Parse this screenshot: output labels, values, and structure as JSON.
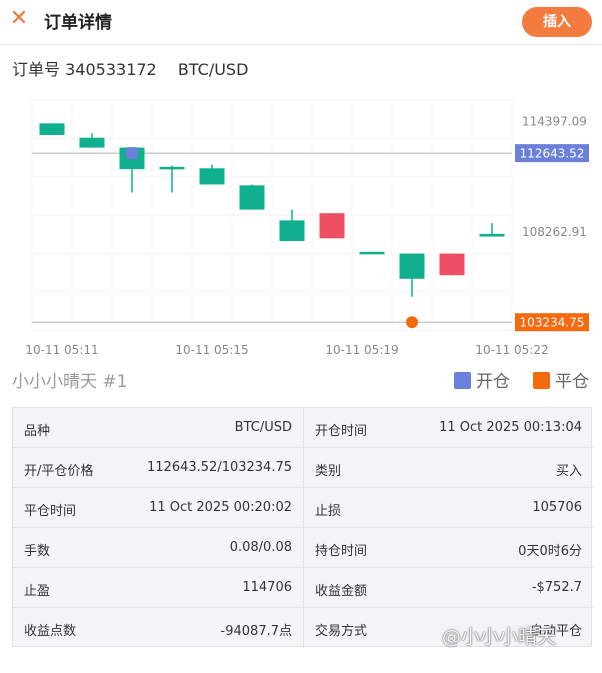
{
  "header": {
    "title": "订单详情",
    "insert_label": "插入"
  },
  "order": {
    "label": "订单号",
    "number": "340533172",
    "symbol": "BTC/USD"
  },
  "legend": {
    "name": "小小小晴天 #1",
    "open_label": "开仓",
    "close_label": "平仓",
    "open_color": "#6b80d9",
    "close_color": "#f5690f"
  },
  "chart_data": {
    "type": "candlestick",
    "y_ticks": [
      "114397.09",
      "108262.91"
    ],
    "x_ticks": [
      "10-11 05:11",
      "10-11 05:15",
      "10-11 05:19",
      "10-11 05:22"
    ],
    "ylim": [
      102800,
      115600
    ],
    "up_color": "#10b08e",
    "down_color": "#ef4f62",
    "candles": [
      {
        "open": 114300,
        "close": 113650,
        "high": 114300,
        "low": 113650,
        "dir": "up"
      },
      {
        "open": 113500,
        "close": 112950,
        "high": 113750,
        "low": 112950,
        "dir": "up"
      },
      {
        "open": 112950,
        "close": 111750,
        "high": 112950,
        "low": 110450,
        "dir": "up"
      },
      {
        "open": 111880,
        "close": 111880,
        "high": 111950,
        "low": 110450,
        "dir": "up"
      },
      {
        "open": 111800,
        "close": 110900,
        "high": 112000,
        "low": 110900,
        "dir": "up"
      },
      {
        "open": 110850,
        "close": 109500,
        "high": 110900,
        "low": 109500,
        "dir": "up"
      },
      {
        "open": 108900,
        "close": 107750,
        "high": 109500,
        "low": 107750,
        "dir": "up"
      },
      {
        "open": 107900,
        "close": 109300,
        "high": 109300,
        "low": 107900,
        "dir": "down"
      },
      {
        "open": 107150,
        "close": 107050,
        "high": 107150,
        "low": 107050,
        "dir": "up"
      },
      {
        "open": 107050,
        "close": 105650,
        "high": 107050,
        "low": 104650,
        "dir": "up"
      },
      {
        "open": 105850,
        "close": 107050,
        "high": 107050,
        "low": 105850,
        "dir": "down"
      },
      {
        "open": 108150,
        "close": 108000,
        "high": 108750,
        "low": 108000,
        "dir": "up"
      }
    ],
    "open_marker": {
      "candle_index": 2,
      "price": 112643.52,
      "label": "112643.52"
    },
    "close_marker": {
      "candle_index": 9,
      "price": 103234.75,
      "label": "103234.75"
    }
  },
  "details": [
    {
      "label": "品种",
      "value": "BTC/USD"
    },
    {
      "label": "开仓时间",
      "value": "11 Oct 2025 00:13:04"
    },
    {
      "label": "开/平仓价格",
      "value": "112643.52/103234.75"
    },
    {
      "label": "类别",
      "value": "买入"
    },
    {
      "label": "平仓时间",
      "value": "11 Oct 2025 00:20:02"
    },
    {
      "label": "止损",
      "value": "105706"
    },
    {
      "label": "手数",
      "value": "0.08/0.08"
    },
    {
      "label": "持仓时间",
      "value": "0天0时6分"
    },
    {
      "label": "止盈",
      "value": "114706"
    },
    {
      "label": "收益金额",
      "value": "-$752.7"
    },
    {
      "label": "收益点数",
      "value": "-94087.7点"
    },
    {
      "label": "交易方式",
      "value": "自动平仓"
    }
  ],
  "watermark": "@小小小晴天"
}
